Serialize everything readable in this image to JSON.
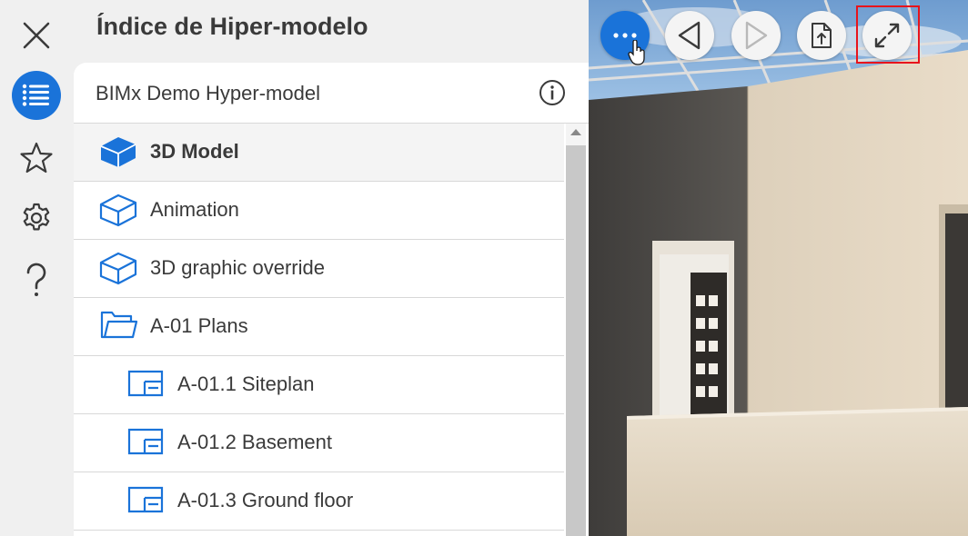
{
  "window": {
    "title": "Índice de Hiper-modelo"
  },
  "rail": {
    "items": [
      {
        "icon": "close-icon"
      },
      {
        "icon": "list-icon",
        "active": true
      },
      {
        "icon": "star-icon"
      },
      {
        "icon": "gear-icon"
      },
      {
        "icon": "help-icon"
      }
    ]
  },
  "model": {
    "name": "BIMx Demo Hyper-model",
    "info_icon": "info-icon"
  },
  "tree": {
    "items": [
      {
        "label": "3D Model",
        "icon": "3d-cube-icon",
        "selected": true
      },
      {
        "label": "Animation",
        "icon": "3d-cube-outline-icon"
      },
      {
        "label": "3D graphic override",
        "icon": "3d-cube-outline-icon"
      },
      {
        "label": "A-01 Plans",
        "icon": "folder-icon"
      },
      {
        "label": "A-01.1 Siteplan",
        "icon": "floorplan-icon"
      },
      {
        "label": "A-01.2 Basement",
        "icon": "floorplan-icon"
      },
      {
        "label": "A-01.3 Ground floor",
        "icon": "floorplan-icon"
      }
    ]
  },
  "toolbar": {
    "buttons": [
      {
        "name": "more",
        "icon": "more-dots-icon"
      },
      {
        "name": "previous",
        "icon": "triangle-left-icon"
      },
      {
        "name": "next",
        "icon": "triangle-right-icon"
      },
      {
        "name": "share",
        "icon": "share-document-icon"
      },
      {
        "name": "fullscreen",
        "icon": "expand-arrows-icon",
        "highlighted": true
      }
    ]
  },
  "colors": {
    "accent": "#1a73d9",
    "highlight": "#e8141c"
  }
}
